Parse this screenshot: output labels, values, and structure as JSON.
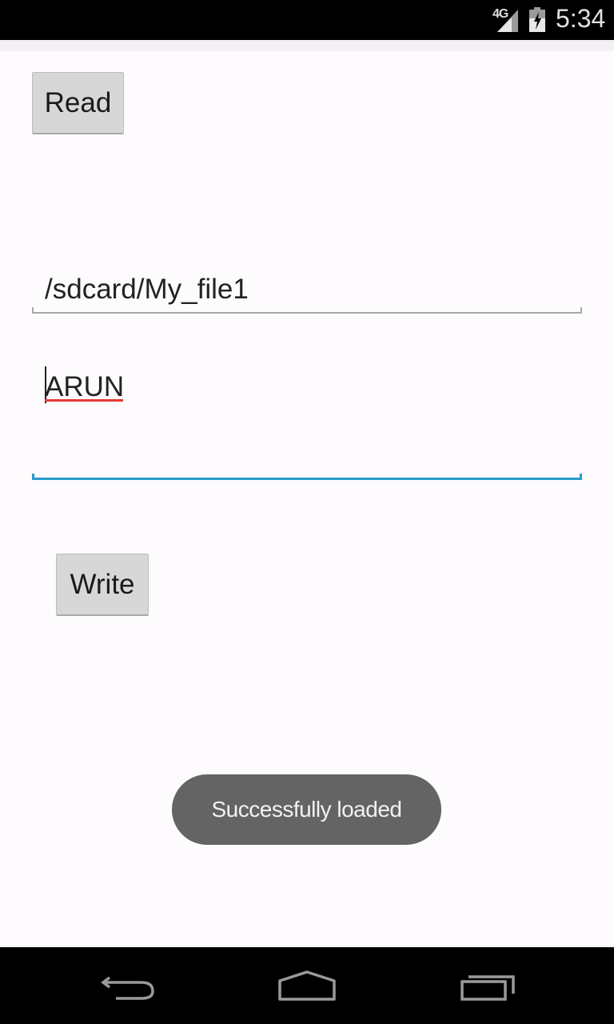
{
  "status_bar": {
    "network": "4G",
    "time": "5:34",
    "icons": [
      "signal-icon",
      "battery-charging-icon"
    ]
  },
  "buttons": {
    "read_label": "Read",
    "write_label": "Write"
  },
  "fields": {
    "path_value": "/sdcard/My_file1",
    "content_value": "ARUN"
  },
  "toast": {
    "message": "Successfully loaded"
  },
  "nav_bar": {
    "icons": [
      "back-icon",
      "home-icon",
      "recents-icon"
    ]
  },
  "colors": {
    "accent": "#2a9bcb",
    "spellcheck": "#e53935",
    "toast_bg": "#646464",
    "button_bg": "#d7d7d7"
  }
}
